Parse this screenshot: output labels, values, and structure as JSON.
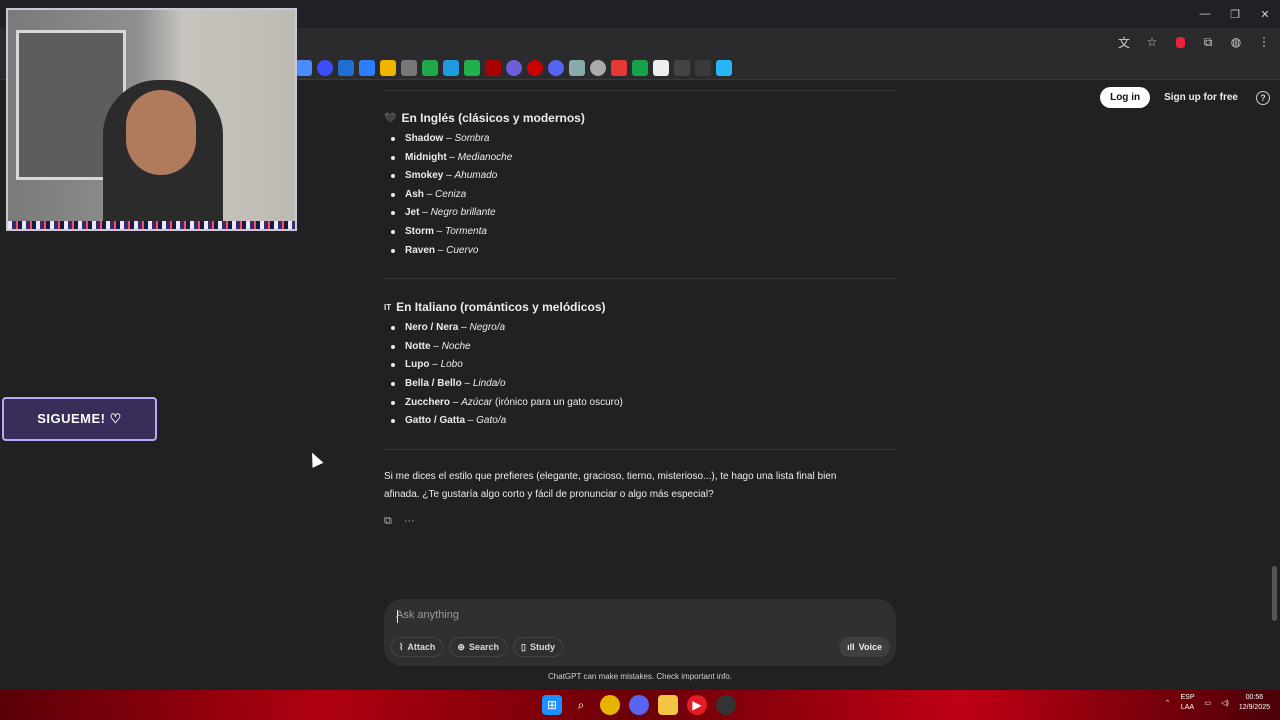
{
  "browser": {
    "window_controls": [
      "—",
      "❐",
      "✕"
    ],
    "toolbar_icons": [
      "translate-icon",
      "star-icon",
      "extension-red-icon",
      "puzzle-icon",
      "profile-icon",
      "menu-icon"
    ]
  },
  "header": {
    "login_label": "Log in",
    "signup_label": "Sign up for free",
    "help_glyph": "?"
  },
  "sections": [
    {
      "emoji": "🖤",
      "title": "En Inglés (clásicos y modernos)",
      "items": [
        {
          "name": "Shadow",
          "translation": "Sombra",
          "note": ""
        },
        {
          "name": "Midnight",
          "translation": "Medianoche",
          "note": ""
        },
        {
          "name": "Smokey",
          "translation": "Ahumado",
          "note": ""
        },
        {
          "name": "Ash",
          "translation": "Ceniza",
          "note": ""
        },
        {
          "name": "Jet",
          "translation": "Negro brillante",
          "note": ""
        },
        {
          "name": "Storm",
          "translation": "Tormenta",
          "note": ""
        },
        {
          "name": "Raven",
          "translation": "Cuervo",
          "note": ""
        }
      ]
    },
    {
      "emoji": "IT",
      "title": "En Italiano (románticos y melódicos)",
      "items": [
        {
          "name": "Nero / Nera",
          "translation": "Negro/a",
          "note": ""
        },
        {
          "name": "Notte",
          "translation": "Noche",
          "note": ""
        },
        {
          "name": "Lupo",
          "translation": "Lobo",
          "note": ""
        },
        {
          "name": "Bella / Bello",
          "translation": "Linda/o",
          "note": ""
        },
        {
          "name": "Zucchero",
          "translation": "Azúcar",
          "note": " (irónico para un gato oscuro)"
        },
        {
          "name": "Gatto / Gatta",
          "translation": "Gato/a",
          "note": ""
        }
      ]
    }
  ],
  "closing_message": "Si me dices el estilo que prefieres (elegante, gracioso, tierno, misterioso...), te hago una lista final bien afinada. ¿Te gustaría algo corto y fácil de pronunciar o algo más especial?",
  "separator": " – ",
  "message_actions": {
    "copy_glyph": "⧉",
    "more_glyph": "···"
  },
  "composer": {
    "placeholder": "Ask anything",
    "attach_label": "Attach",
    "search_label": "Search",
    "study_label": "Study",
    "voice_label": "Voice"
  },
  "disclaimer": "ChatGPT can make mistakes. Check important info.",
  "overlay": {
    "follow_label": "SIGUEME! ♡"
  },
  "taskbar": {
    "language_top": "ESP",
    "language_bottom": "LAA",
    "time": "00:56",
    "date": "12/9/2025"
  },
  "colors": {
    "page_bg": "#212121",
    "composer_bg": "#303030",
    "taskbar_red": "#b00010"
  }
}
